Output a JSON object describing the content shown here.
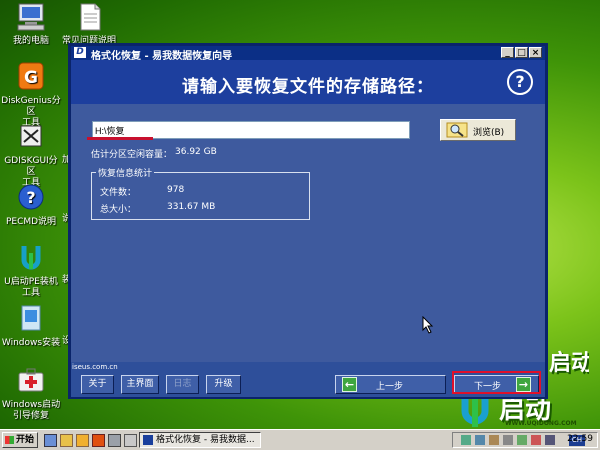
{
  "desktop": {
    "icons": [
      {
        "label": "我的电脑",
        "icon": "computer-icon"
      },
      {
        "label": "常见问题说明",
        "icon": "document-icon"
      },
      {
        "label": "DiskGenius分区\n工具",
        "icon": "diskgenius-icon"
      },
      {
        "label": "GDISKGUI分区\n工具",
        "icon": "gdisk-icon"
      },
      {
        "label": "PECMD说明",
        "icon": "help-icon"
      },
      {
        "label": "U启动PE装机\n工具",
        "icon": "uqidong-icon"
      },
      {
        "label": "Windows安装",
        "icon": "windows-install-icon"
      },
      {
        "label": "Windows启动\n引导修复",
        "icon": "firstaid-icon"
      }
    ],
    "cut_labels": [
      "加",
      "说",
      "装",
      "设"
    ]
  },
  "window": {
    "title": "格式化恢复 - 易我数据恢复向导",
    "header": "请输入要恢复文件的存储路径：",
    "help": "?",
    "path_value": "H:\\恢复",
    "browse_label": "浏览(B)",
    "space_label": "估计分区空闲容量：",
    "space_value": "36.92 GB",
    "group_title": "恢复信息统计",
    "file_count_label": "文件数：",
    "file_count_value": "978",
    "total_size_label": "总大小：",
    "total_size_value": "331.67 MB",
    "url": "iseus.com.cn",
    "buttons": {
      "about": "关于",
      "main": "主界面",
      "log": "日志",
      "upgrade": "升级",
      "prev": "上一步",
      "next": "下一步"
    }
  },
  "brand": {
    "text": "启动",
    "url": "WWW.UQIDONG.COM"
  },
  "taskbar": {
    "start": "开始",
    "task": "格式化恢复 - 易我数据...",
    "ime": "CH",
    "clock": "22:59"
  },
  "colors": {
    "accent_red": "#e0102a",
    "window_blue": "#3e5a9e",
    "header_blue": "#1d3f9e"
  }
}
